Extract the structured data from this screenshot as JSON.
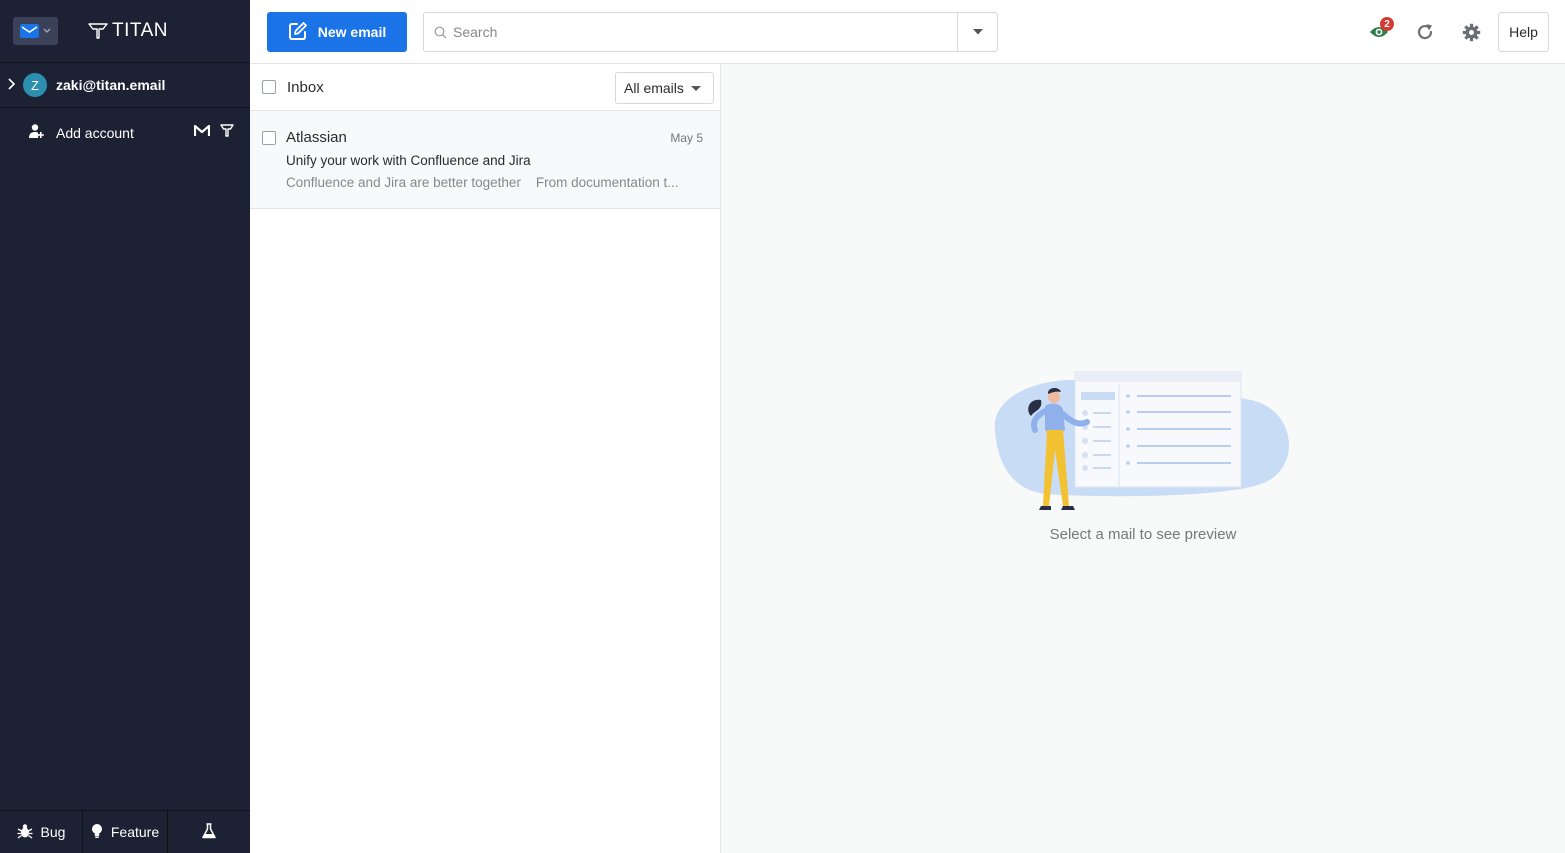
{
  "sidebar": {
    "brand": "TITAN",
    "account": {
      "initial": "Z",
      "email": "zaki@titan.email"
    },
    "add_account_label": "Add account",
    "bottom": {
      "bug_label": "Bug",
      "feature_label": "Feature"
    }
  },
  "toolbar": {
    "new_email_label": "New email",
    "search_placeholder": "Search",
    "notification_count": "2",
    "help_label": "Help"
  },
  "list": {
    "folder_title": "Inbox",
    "filter_value": "All emails",
    "emails": [
      {
        "sender": "Atlassian",
        "date": "May 5",
        "subject": "Unify your work with Confluence and Jira",
        "preview": "Confluence and Jira are better together    From documentation t..."
      }
    ]
  },
  "preview": {
    "empty_message": "Select a mail to see preview"
  },
  "colors": {
    "sidebar_bg": "#1d2134",
    "accent": "#1b73e8",
    "badge": "#d13b32"
  }
}
